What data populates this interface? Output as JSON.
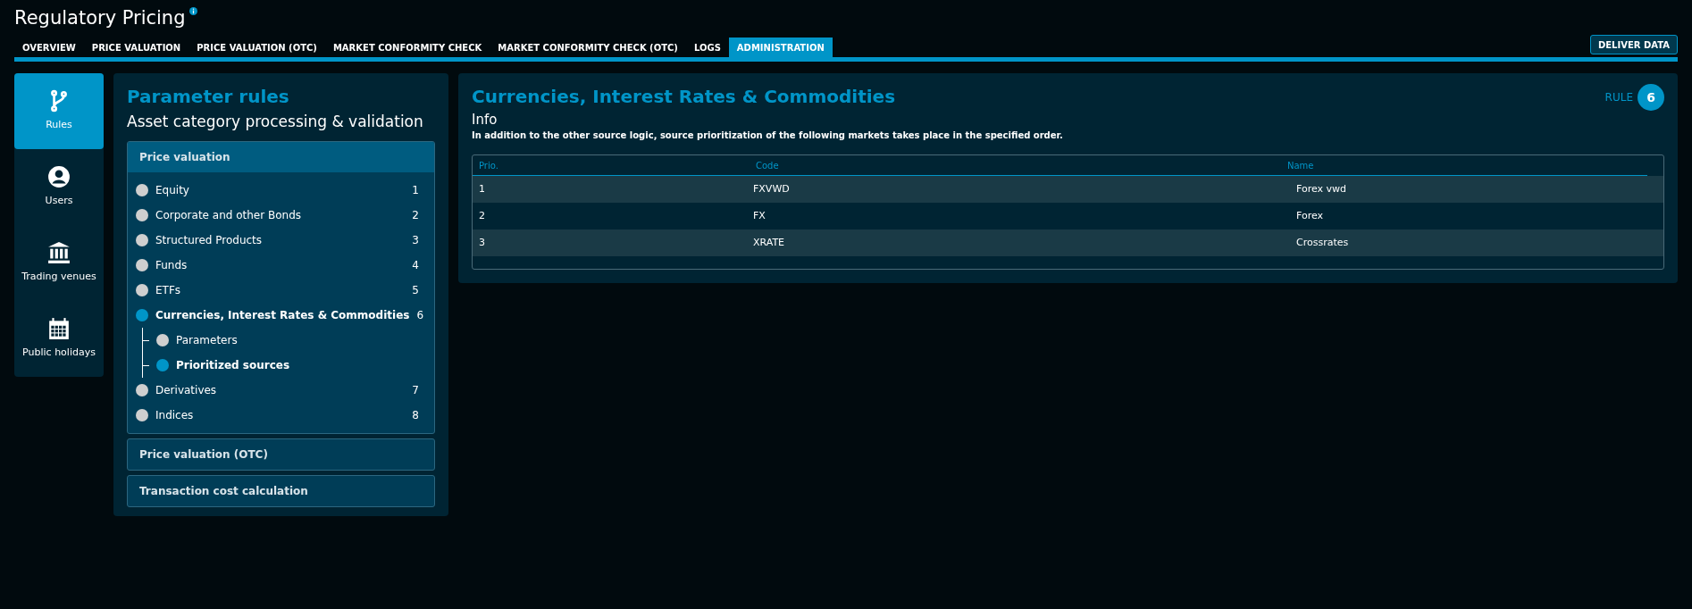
{
  "app": {
    "title": "Regulatory Pricing"
  },
  "tabs": [
    {
      "label": "OVERVIEW",
      "selected": false
    },
    {
      "label": "PRICE VALUATION",
      "selected": false
    },
    {
      "label": "PRICE VALUATION (OTC)",
      "selected": false
    },
    {
      "label": "MARKET CONFORMITY CHECK",
      "selected": false
    },
    {
      "label": "MARKET CONFORMITY CHECK (OTC)",
      "selected": false
    },
    {
      "label": "LOGS",
      "selected": false
    },
    {
      "label": "ADMINISTRATION",
      "selected": true
    }
  ],
  "deliver_button": "DELIVER DATA",
  "nav": [
    {
      "kind": "branch",
      "label": "Rules",
      "selected": true
    },
    {
      "kind": "user",
      "label": "Users",
      "selected": false
    },
    {
      "kind": "bank",
      "label": "Trading venues",
      "selected": false
    },
    {
      "kind": "calendar",
      "label": "Public holidays",
      "selected": false
    }
  ],
  "rules_panel": {
    "title": "Parameter rules",
    "subtitle": "Asset category processing & validation",
    "sections": [
      {
        "title": "Price valuation",
        "expanded": true,
        "items": [
          {
            "label": "Equity",
            "number": "1",
            "selected": false
          },
          {
            "label": "Corporate and other Bonds",
            "number": "2",
            "selected": false
          },
          {
            "label": "Structured Products",
            "number": "3",
            "selected": false
          },
          {
            "label": "Funds",
            "number": "4",
            "selected": false
          },
          {
            "label": "ETFs",
            "number": "5",
            "selected": false
          },
          {
            "label": "Currencies, Interest Rates & Commodities",
            "number": "6",
            "selected": true,
            "children": [
              {
                "label": "Parameters",
                "selected": false
              },
              {
                "label": "Prioritized sources",
                "selected": true
              }
            ]
          },
          {
            "label": "Derivatives",
            "number": "7",
            "selected": false
          },
          {
            "label": "Indices",
            "number": "8",
            "selected": false
          }
        ]
      },
      {
        "title": "Price valuation (OTC)",
        "expanded": false
      },
      {
        "title": "Transaction cost calculation",
        "expanded": false
      }
    ]
  },
  "detail": {
    "title": "Currencies, Interest Rates & Commodities",
    "rule_label": "RULE",
    "rule_number": "6",
    "info_heading": "Info",
    "info_text": "In addition to the other source logic, source prioritization of the following markets takes place in the specified order.",
    "table": {
      "columns": [
        "Prio.",
        "Code",
        "Name"
      ],
      "rows": [
        [
          "1",
          "FXVWD",
          "Forex vwd"
        ],
        [
          "2",
          "FX",
          "Forex"
        ],
        [
          "3",
          "XRATE",
          "Crossrates"
        ]
      ]
    }
  }
}
